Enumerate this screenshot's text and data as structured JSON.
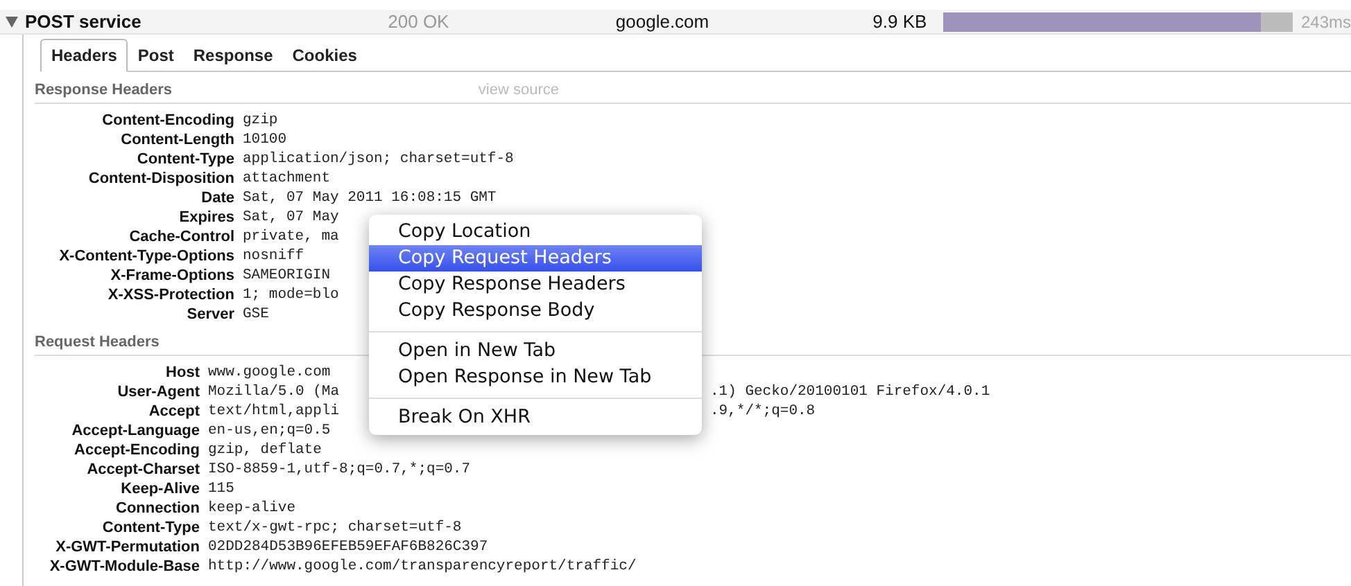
{
  "request": {
    "expanded": true,
    "name": "POST service",
    "status": "200 OK",
    "domain": "google.com",
    "size": "9.9 KB",
    "level": 0.91,
    "time": "243ms"
  },
  "tabs": [
    {
      "label": "Headers",
      "selected": true
    },
    {
      "label": "Post",
      "selected": false
    },
    {
      "label": "Response",
      "selected": false
    },
    {
      "label": "Cookies",
      "selected": false
    }
  ],
  "response_headers": {
    "title": "Response Headers",
    "link": "view source",
    "rows": [
      {
        "name": "Content-Encoding",
        "value": "gzip"
      },
      {
        "name": "Content-Length",
        "value": "10100"
      },
      {
        "name": "Content-Type",
        "value": "application/json; charset=utf-8"
      },
      {
        "name": "Content-Disposition",
        "value": "attachment"
      },
      {
        "name": "Date",
        "value": "Sat, 07 May 2011 16:08:15 GMT"
      },
      {
        "name": "Expires",
        "value": "Sat, 07 May"
      },
      {
        "name": "Cache-Control",
        "value": "private, ma"
      },
      {
        "name": "X-Content-Type-Options",
        "value": "nosniff"
      },
      {
        "name": "X-Frame-Options",
        "value": "SAMEORIGIN"
      },
      {
        "name": "X-XSS-Protection",
        "value": "1; mode=blo"
      },
      {
        "name": "Server",
        "value": "GSE"
      }
    ]
  },
  "request_headers": {
    "title": "Request Headers",
    "rows": [
      {
        "name": "Host",
        "value": "www.google.com"
      },
      {
        "name": "User-Agent",
        "value": "Mozilla/5.0 (Ma",
        "tail": ".1) Gecko/20100101 Firefox/4.0.1"
      },
      {
        "name": "Accept",
        "value": "text/html,appli",
        "tail": ".9,*/*;q=0.8"
      },
      {
        "name": "Accept-Language",
        "value": "en-us,en;q=0.5"
      },
      {
        "name": "Accept-Encoding",
        "value": "gzip, deflate"
      },
      {
        "name": "Accept-Charset",
        "value": "ISO-8859-1,utf-8;q=0.7,*;q=0.7"
      },
      {
        "name": "Keep-Alive",
        "value": "115"
      },
      {
        "name": "Connection",
        "value": "keep-alive"
      },
      {
        "name": "Content-Type",
        "value": "text/x-gwt-rpc; charset=utf-8"
      },
      {
        "name": "X-GWT-Permutation",
        "value": "02DD284D53B96EFEB59EFAF6B826C397"
      },
      {
        "name": "X-GWT-Module-Base",
        "value": "http://www.google.com/transparencyreport/traffic/"
      }
    ]
  },
  "context_menu": [
    {
      "kind": "item",
      "label": "Copy Location",
      "selected": false
    },
    {
      "kind": "item",
      "label": "Copy Request Headers",
      "selected": true
    },
    {
      "kind": "item",
      "label": "Copy Response Headers",
      "selected": false
    },
    {
      "kind": "item",
      "label": "Copy Response Body",
      "selected": false
    },
    {
      "kind": "separator"
    },
    {
      "kind": "item",
      "label": "Open in New Tab",
      "selected": false
    },
    {
      "kind": "item",
      "label": "Open Response in New Tab",
      "selected": false
    },
    {
      "kind": "separator"
    },
    {
      "kind": "item",
      "label": "Break On XHR",
      "selected": false
    }
  ]
}
